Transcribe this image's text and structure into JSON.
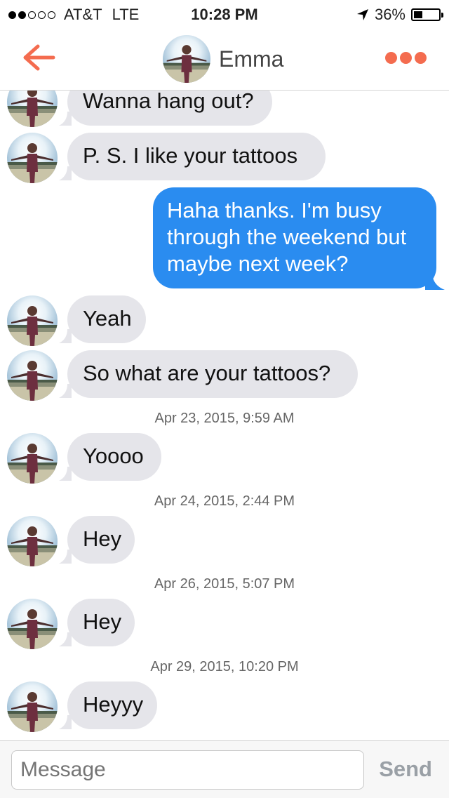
{
  "status_bar": {
    "carrier": "AT&T",
    "network": "LTE",
    "time": "10:28 PM",
    "battery_text": "36%",
    "battery_level": 0.36,
    "signal_bars_filled": 2,
    "signal_bars_total": 5
  },
  "header": {
    "title": "Emma",
    "back_icon": "back-arrow-icon",
    "more_icon": "more-options-icon",
    "accent_color": "#f46c4f"
  },
  "messages": [
    {
      "type": "incoming",
      "text": "Wanna hang out?"
    },
    {
      "type": "incoming",
      "text": "P. S. I like your tattoos"
    },
    {
      "type": "outgoing",
      "lines": [
        "Haha thanks. I'm busy",
        "through the weekend but",
        "maybe next week?"
      ]
    },
    {
      "type": "incoming",
      "text": "Yeah"
    },
    {
      "type": "incoming",
      "text": "So what are your tattoos?"
    },
    {
      "type": "timestamp",
      "text": "Apr 23, 2015, 9:59 AM"
    },
    {
      "type": "incoming",
      "text": "Yoooo"
    },
    {
      "type": "timestamp",
      "text": "Apr 24, 2015, 2:44 PM"
    },
    {
      "type": "incoming",
      "text": "Hey"
    },
    {
      "type": "timestamp",
      "text": "Apr 26, 2015, 5:07 PM"
    },
    {
      "type": "incoming",
      "text": "Hey"
    },
    {
      "type": "timestamp",
      "text": "Apr 29, 2015, 10:20 PM"
    },
    {
      "type": "incoming",
      "text": "Heyyy"
    }
  ],
  "composer": {
    "placeholder": "Message",
    "send_label": "Send"
  },
  "colors": {
    "outgoing_bubble": "#2a8cf0",
    "incoming_bubble": "#e5e5ea"
  }
}
